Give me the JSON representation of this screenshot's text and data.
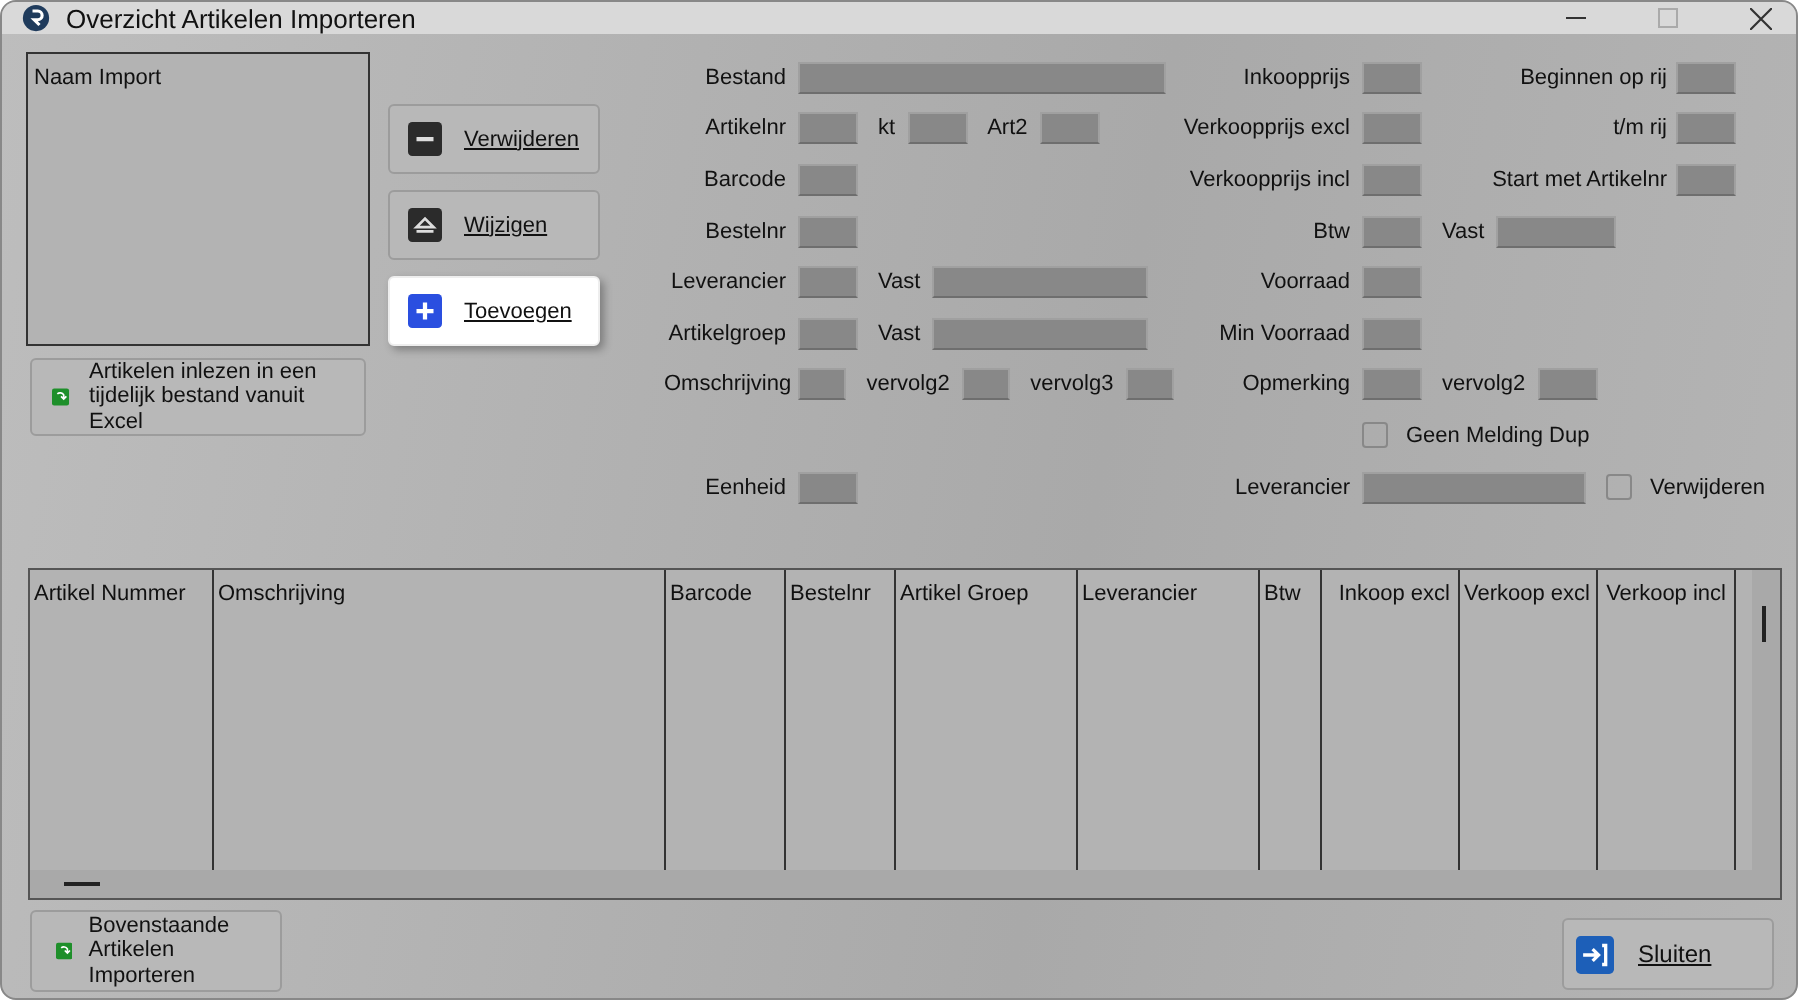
{
  "window": {
    "title": "Overzicht Artikelen Importeren"
  },
  "import_list": {
    "header": "Naam Import"
  },
  "side_buttons": [
    {
      "label": "Verwijderen",
      "kind": "minus",
      "highlighted": false
    },
    {
      "label": "Wijzigen",
      "kind": "eject",
      "highlighted": false
    },
    {
      "label": "Toevoegen",
      "kind": "plus",
      "highlighted": true
    }
  ],
  "excel_button": {
    "label": "Artikelen inlezen in een tijdelijk bestand vanuit Excel"
  },
  "form_rows": [
    {
      "left": [
        {
          "label": "Bestand",
          "kind": "wide"
        }
      ],
      "middle": [
        {
          "label": "Inkoopprijs",
          "kind": "short"
        }
      ],
      "right": [
        {
          "label": "Beginnen op rij",
          "kind": "short"
        }
      ]
    },
    {
      "left": [
        {
          "label": "Artikelnr",
          "kind": "short"
        },
        {
          "label": "kt",
          "kind": "short"
        },
        {
          "label": "Art2",
          "kind": "short"
        }
      ],
      "middle": [
        {
          "label": "Verkoopprijs excl",
          "kind": "short"
        }
      ],
      "right": [
        {
          "label": "t/m rij",
          "kind": "short"
        }
      ]
    },
    {
      "left": [
        {
          "label": "Barcode",
          "kind": "short"
        }
      ],
      "middle": [
        {
          "label": "Verkoopprijs incl",
          "kind": "short"
        }
      ],
      "right": [
        {
          "label": "Start met Artikelnr",
          "kind": "short"
        }
      ]
    },
    {
      "left": [
        {
          "label": "Bestelnr",
          "kind": "short"
        }
      ],
      "middle": [
        {
          "label": "Btw",
          "kind": "short"
        },
        {
          "label": "Vast",
          "kind": "medium"
        }
      ],
      "right": []
    },
    {
      "left": [
        {
          "label": "Leverancier",
          "kind": "short"
        },
        {
          "label": "Vast",
          "kind": "long"
        }
      ],
      "middle": [
        {
          "label": "Voorraad",
          "kind": "short"
        }
      ],
      "right": []
    },
    {
      "left": [
        {
          "label": "Artikelgroep",
          "kind": "short"
        },
        {
          "label": "Vast",
          "kind": "long"
        }
      ],
      "middle": [
        {
          "label": "Min Voorraad",
          "kind": "short"
        }
      ],
      "right": []
    },
    {
      "left": [
        {
          "label": "Omschrijving",
          "kind": "short"
        },
        {
          "label": "vervolg2",
          "kind": "short"
        },
        {
          "label": "vervolg3",
          "kind": "short"
        }
      ],
      "middle": [
        {
          "label": "Opmerking",
          "kind": "short"
        },
        {
          "label": "vervolg2",
          "kind": "short"
        }
      ],
      "right": []
    },
    {
      "left": [],
      "middle": [
        {
          "label": "Geen Melding Dup",
          "kind": "checkbox",
          "checked": false
        }
      ],
      "right": []
    },
    {
      "left": [
        {
          "label": "Eenheid",
          "kind": "short"
        }
      ],
      "middle": [
        {
          "label": "Leverancier",
          "kind": "long"
        },
        {
          "label": "Verwijderen",
          "kind": "checkbox",
          "checked": false
        }
      ],
      "right": []
    }
  ],
  "table": {
    "columns": [
      "Artikel Nummer",
      "Omschrijving",
      "Barcode",
      "Bestelnr",
      "Artikel Groep",
      "Leverancier",
      "Btw",
      "Inkoop excl",
      "Verkoop excl",
      "Verkoop incl"
    ]
  },
  "import_button": {
    "label": "Bovenstaande Artikelen Importeren"
  },
  "close_button": {
    "label": "Sluiten"
  }
}
